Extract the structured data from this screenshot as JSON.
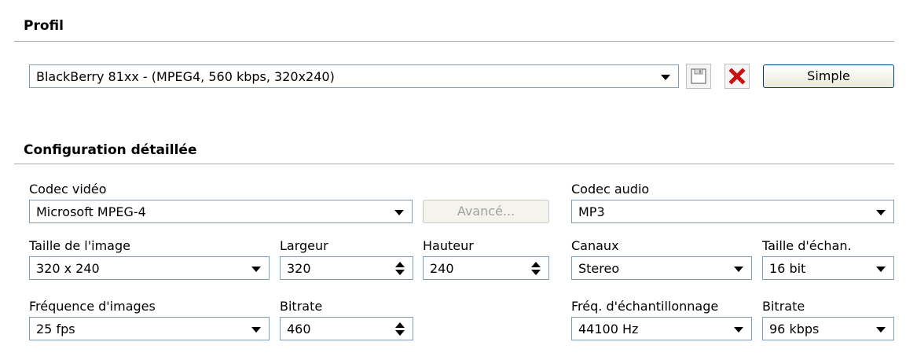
{
  "profile": {
    "title": "Profil",
    "selected": "BlackBerry 81xx - (MPEG4, 560 kbps, 320x240)",
    "save_icon": "floppy-disk-icon",
    "delete_icon": "red-x-icon",
    "simple_button": "Simple"
  },
  "detailed": {
    "title": "Configuration détaillée",
    "video_codec": {
      "label": "Codec vidéo",
      "value": "Microsoft MPEG-4"
    },
    "advanced_button": "Avancé...",
    "audio_codec": {
      "label": "Codec audio",
      "value": "MP3"
    },
    "image_size": {
      "label": "Taille de l'image",
      "value": "320 x 240"
    },
    "width": {
      "label": "Largeur",
      "value": "320"
    },
    "height": {
      "label": "Hauteur",
      "value": "240"
    },
    "channels": {
      "label": "Canaux",
      "value": "Stereo"
    },
    "sample_size": {
      "label": "Taille d'échan.",
      "value": "16 bit"
    },
    "frame_rate": {
      "label": "Fréquence d'images",
      "value": "25 fps"
    },
    "video_bitrate": {
      "label": "Bitrate",
      "value": "460"
    },
    "sample_rate": {
      "label": "Fréq. d'échantillonnage",
      "value": "44100 Hz"
    },
    "audio_bitrate": {
      "label": "Bitrate",
      "value": "96 kbps"
    }
  }
}
